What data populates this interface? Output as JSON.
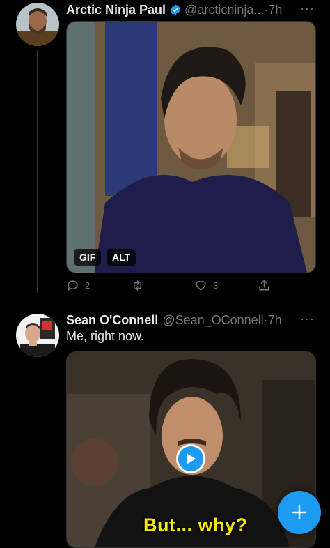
{
  "tweets": [
    {
      "author_name": "Arctic Ninja Paul",
      "handle": "@arcticninja...",
      "separator": "·",
      "time": "7h",
      "more_label": "···",
      "media_badges": [
        "GIF",
        "ALT"
      ],
      "actions": {
        "reply_count": "2",
        "retweet_count": "",
        "like_count": "3"
      }
    },
    {
      "author_name": "Sean O'Connell",
      "handle": "@Sean_OConnell",
      "separator": "·",
      "time": "7h",
      "more_label": "···",
      "text": "Me, right now.",
      "media_caption": "But... why?"
    }
  ],
  "colors": {
    "accent": "#1d9bf0",
    "muted": "#71767b",
    "background": "#000000"
  },
  "icons": [
    "verified-badge-icon",
    "reply-icon",
    "retweet-icon",
    "like-icon",
    "share-icon",
    "play-icon",
    "compose-plus-icon"
  ]
}
